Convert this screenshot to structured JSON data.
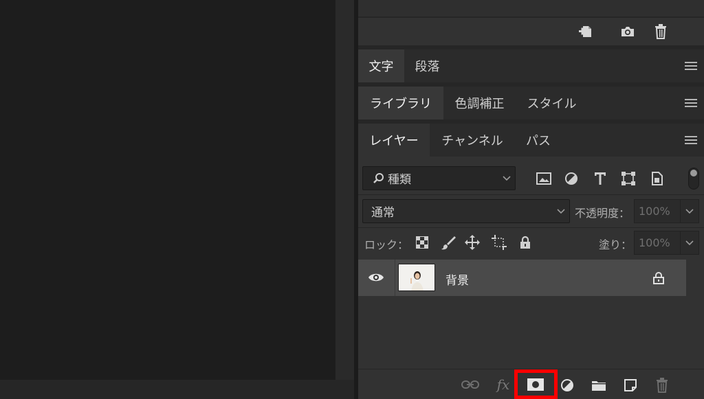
{
  "history_panel": {
    "icons": [
      "new-document-from-state-icon",
      "camera-icon",
      "trash-icon"
    ]
  },
  "type_panel": {
    "tabs": [
      {
        "label": "文字",
        "active": true
      },
      {
        "label": "段落",
        "active": false
      }
    ]
  },
  "library_panel": {
    "tabs": [
      {
        "label": "ライブラリ",
        "active": true
      },
      {
        "label": "色調補正",
        "active": false
      },
      {
        "label": "スタイル",
        "active": false
      }
    ]
  },
  "layers_panel": {
    "tabs": [
      {
        "label": "レイヤー",
        "active": true
      },
      {
        "label": "チャンネル",
        "active": false
      },
      {
        "label": "パス",
        "active": false
      }
    ],
    "filter": {
      "value": "種類",
      "icons": [
        "image-filter-icon",
        "adjustment-filter-icon",
        "type-filter-icon",
        "shape-filter-icon",
        "smart-object-filter-icon"
      ]
    },
    "blend_mode": "通常",
    "opacity_label": "不透明度：",
    "opacity_value": "100%",
    "lock_label": "ロック：",
    "lock_icons": [
      "lock-transparent-pixels-icon",
      "lock-image-pixels-icon",
      "lock-position-icon",
      "lock-artboard-icon",
      "lock-all-icon"
    ],
    "fill_label": "塗り：",
    "fill_value": "100%",
    "layers": [
      {
        "name": "背景",
        "visible": true,
        "locked": true
      }
    ],
    "bottom_icons": [
      "link-layers-icon",
      "fx-icon",
      "add-mask-icon",
      "adjustment-layer-icon",
      "group-folder-icon",
      "new-layer-icon",
      "delete-layer-icon"
    ]
  },
  "colors": {
    "highlight": "#ff0000",
    "panel_bg": "#323232",
    "selected_row": "#4a4a4a"
  }
}
